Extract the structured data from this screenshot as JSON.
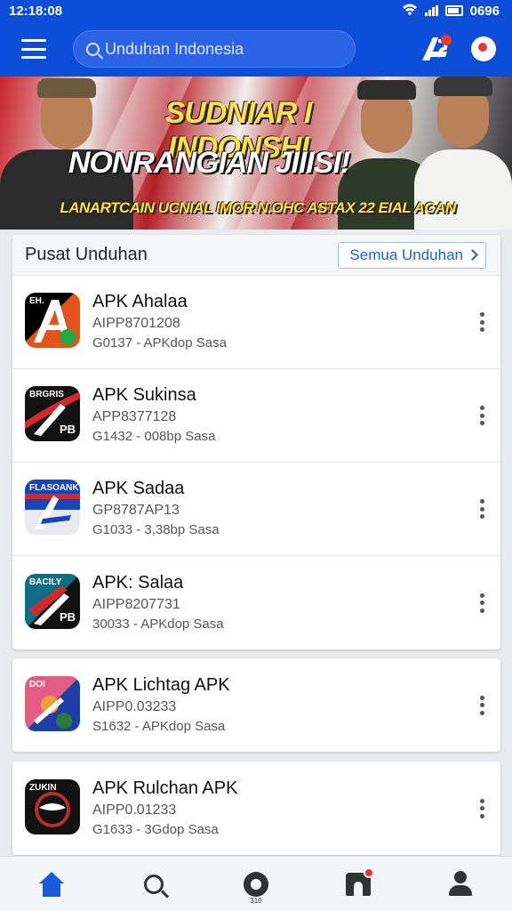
{
  "status_bar": {
    "time": "12:18:08",
    "battery": "0696"
  },
  "app_bar": {
    "search_text": "Unduhan Indonesia"
  },
  "banner": {
    "headline": "SUDNIAR I INDONSHI",
    "subheadline": "NONRANGIAN JIIISI!",
    "caption": "LANARTCAIN UCNIAL IMOR N.OHC ASTAX 22 EIAL ACAN"
  },
  "section": {
    "title": "Pusat Unduhan",
    "more_label": "Semua Unduhan"
  },
  "apps": [
    {
      "name": "APK  Ahalaa",
      "id": "AIPP8701208",
      "meta": "G0137 - APKdop Sasa",
      "tag": "EH.",
      "colors": [
        "#000000",
        "#e2541c"
      ]
    },
    {
      "name": "APK  Sukinsa",
      "id": "APP8377128",
      "meta": "G1432 - 008bp Sasa",
      "tag": "BRGRIS",
      "colors": [
        "#111111",
        "#d22a2a"
      ]
    },
    {
      "name": "APK  Sadaa",
      "id": "GP8787AP13",
      "meta": "G1033 - 3,38bp Sasa",
      "tag": "FLASOANK",
      "colors": [
        "#1846b8",
        "#e9e9ef"
      ]
    },
    {
      "name": "APK:  Salaa",
      "id": "AIPP8207731",
      "meta": "30033 - APKdop Sasa",
      "tag": "BACILY",
      "colors": [
        "#0e6e84",
        "#111111"
      ]
    },
    {
      "name": "APK  Lichtag  APK",
      "id": "AIPP0.03233",
      "meta": "S1632 - APKdop Sasa",
      "tag": "DOI",
      "colors": [
        "#e25d85",
        "#1e3ea8"
      ]
    },
    {
      "name": "APK  Rulchan  APK",
      "id": "AIPP0.01233",
      "meta": "G1633 - 3Gdop Sasa",
      "tag": "ZUKIN",
      "colors": [
        "#111111",
        "#b82c2c"
      ]
    }
  ],
  "bottom_nav": {
    "chat_sub": "310"
  }
}
